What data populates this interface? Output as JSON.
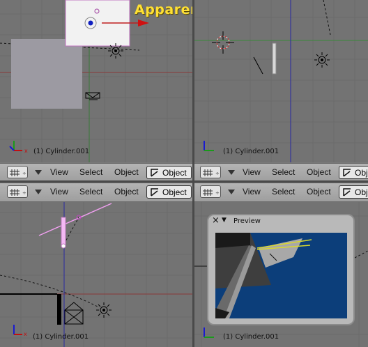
{
  "overlay_title": "Apparent Dual Sun source!",
  "viewports": [
    {
      "info": "(1) Cylinder.001"
    },
    {
      "info": "(1) Cylinder.001"
    },
    {
      "info": "(1) Cylinder.001"
    },
    {
      "info": "(1) Cylinder.001"
    }
  ],
  "headers": [
    {
      "view": "View",
      "select": "Select",
      "object": "Object",
      "mode": "Object"
    },
    {
      "view": "View",
      "select": "Select",
      "object": "Object",
      "mode": "Obj"
    },
    {
      "view": "View",
      "select": "Select",
      "object": "Object",
      "mode": "Object"
    },
    {
      "view": "View",
      "select": "Select",
      "object": "Object",
      "mode": "Obj"
    }
  ],
  "preview": {
    "title": "Preview",
    "close": "×",
    "menu": "▼"
  },
  "colors": {
    "overlay_text": "#ffe033",
    "viewport_bg": "#737373",
    "preview_bg": "#0c3e7a"
  }
}
